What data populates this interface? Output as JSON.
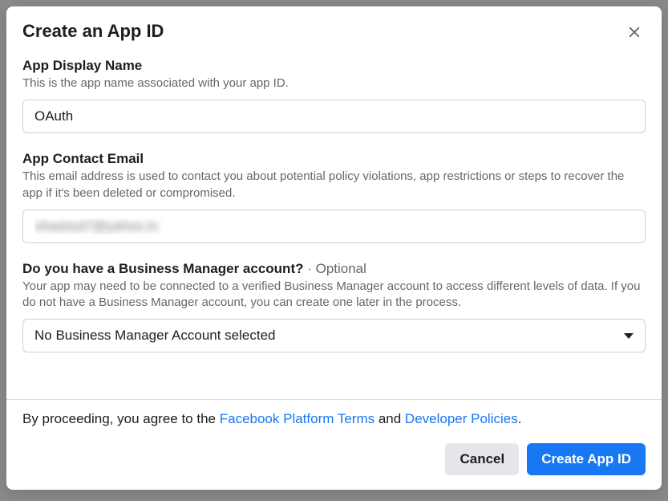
{
  "modal": {
    "title": "Create an App ID",
    "close_icon": "close"
  },
  "display_name": {
    "label": "App Display Name",
    "help": "This is the app name associated with your app ID.",
    "value": "OAuth"
  },
  "contact_email": {
    "label": "App Contact Email",
    "help": "This email address is used to contact you about potential policy violations, app restrictions or steps to recover the app if it's been deleted or compromised.",
    "value": "shwetud7@yahoo.in"
  },
  "business_manager": {
    "label": "Do you have a Business Manager account?",
    "optional": " · Optional",
    "help": "Your app may need to be connected to a verified Business Manager account to access different levels of data. If you do not have a Business Manager account, you can create one later in the process.",
    "selected": "No Business Manager Account selected"
  },
  "footer": {
    "agree_prefix": "By proceeding, you agree to the ",
    "link1": "Facebook Platform Terms",
    "mid": " and ",
    "link2": "Developer Policies",
    "suffix": ".",
    "cancel": "Cancel",
    "create": "Create App ID"
  }
}
